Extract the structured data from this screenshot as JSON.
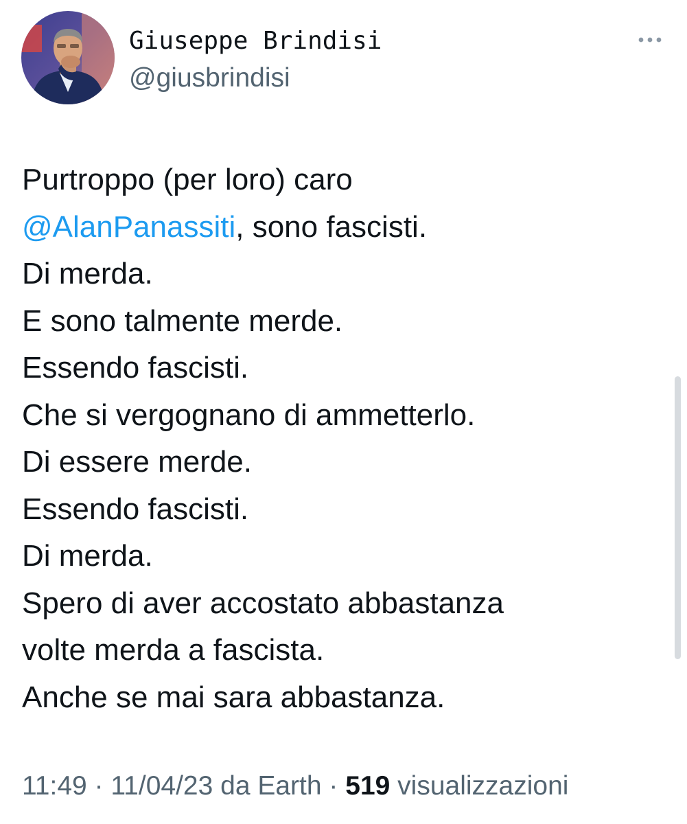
{
  "author": {
    "display_name": "Giuseppe Brindisi",
    "handle": "@giusbrindisi",
    "avatar_icon": "profile-photo"
  },
  "more_icon": "ellipsis-icon",
  "tweet": {
    "line1": "Purtroppo (per loro) caro",
    "mention": "@AlanPanassiti",
    "line2_rest": ", sono fascisti.",
    "line3": "Di merda.",
    "line4": "E sono talmente merde.",
    "line5": "Essendo fascisti.",
    "line6": "Che si vergognano di ammetterlo.",
    "line7": "Di essere merde.",
    "line8": "Essendo fascisti.",
    "line9": "Di merda.",
    "line10": "Spero di aver accostato abbastanza",
    "line11": "volte merda a fascista.",
    "line12": "Anche se mai sara abbastanza."
  },
  "meta": {
    "time": "11:49",
    "separator1": " · ",
    "date": "11/04/23",
    "source_prefix": " da ",
    "source": "Earth",
    "separator2": " · ",
    "views_count": "519",
    "views_label": " visualizzazioni"
  },
  "colors": {
    "text": "#0f1419",
    "secondary": "#536471",
    "link": "#1d9bf0"
  }
}
